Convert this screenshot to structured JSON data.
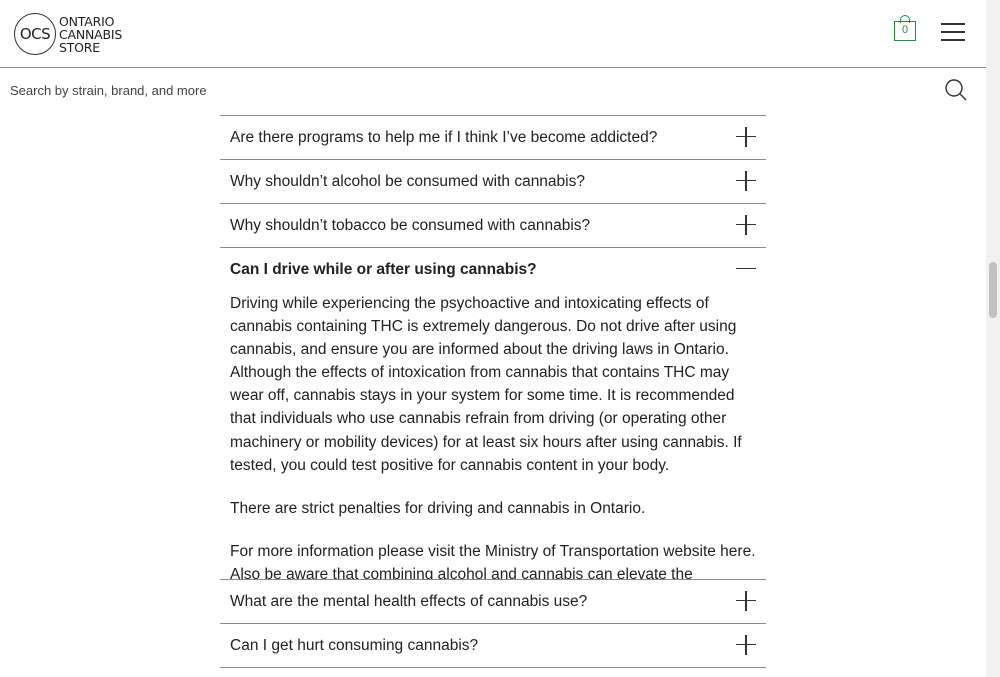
{
  "header": {
    "logo_initials": "OCS",
    "logo_line1": "ONTARIO",
    "logo_line2": "CANNABIS",
    "logo_line3": "STORE",
    "cart_count": "0",
    "icons": {
      "cart": "shopping-bag-icon",
      "menu": "hamburger-menu-icon",
      "search": "search-icon"
    }
  },
  "search": {
    "placeholder": "Search by strain, brand, and more"
  },
  "faq": {
    "items_before": [
      {
        "question": "Are there programs to help me if I think I’ve become addicted?"
      },
      {
        "question": "Why shouldn’t alcohol be consumed with cannabis?"
      },
      {
        "question": "Why shouldn’t tobacco be consumed with cannabis?"
      }
    ],
    "open_item": {
      "question": "Can I drive while or after using cannabis?",
      "paragraphs": [
        "Driving while experiencing the psychoactive and intoxicating effects of cannabis containing THC is extremely dangerous. Do not drive after using cannabis, and ensure you are informed about the driving laws in Ontario. Although the effects of intoxication from cannabis that contains THC may wear off, cannabis stays in your system for some time. It is recommended that individuals who use cannabis refrain from driving (or operating other machinery or mobility devices) for at least six hours after using cannabis. If tested, you could test positive for cannabis content in your body.",
        "There are strict penalties for driving and cannabis in Ontario.",
        "For more information please visit the Ministry of Transportation website here.  Also be aware that combining alcohol and cannabis can elevate the"
      ]
    },
    "items_after": [
      {
        "question": "What are the mental health effects of cannabis use?"
      },
      {
        "question": "Can I get hurt consuming cannabis?"
      }
    ]
  },
  "colors": {
    "accent_green": "#2e8b3d",
    "divider": "#8a8a8a"
  }
}
